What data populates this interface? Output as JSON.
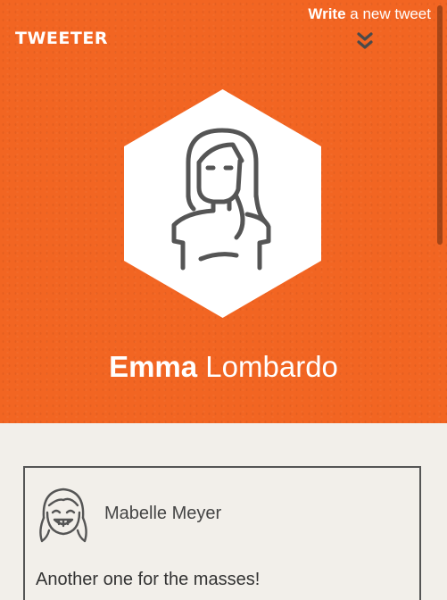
{
  "colors": {
    "hero_background": "#f26522",
    "page_background": "#f2efea",
    "text_light": "#ffffff",
    "icon_stroke": "#555555"
  },
  "header": {
    "logo": "TWEETER",
    "compose_strong": "Write",
    "compose_rest": " a new tweet",
    "compose_icon": "double-chevron-down-icon"
  },
  "profile": {
    "first_name": "Emma",
    "last_name": " Lombardo",
    "avatar_icon": "woman-avatar-icon"
  },
  "tweets": [
    {
      "author": "Mabelle Meyer",
      "text": "Another one for the masses!",
      "avatar_icon": "girl-avatar-icon"
    }
  ]
}
